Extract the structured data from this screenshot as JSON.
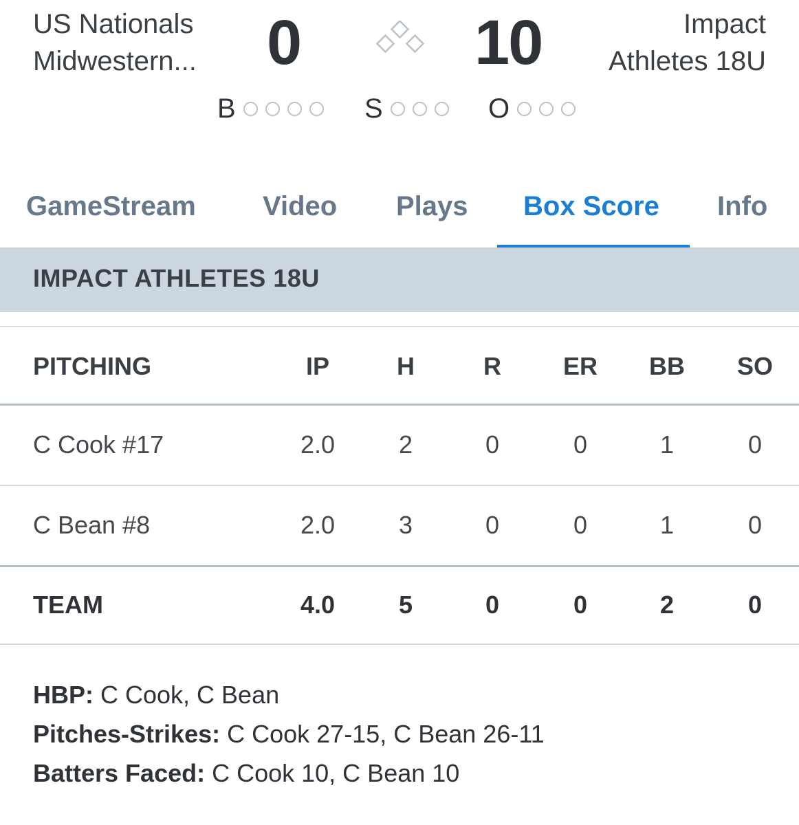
{
  "scoreboard": {
    "away_team_line1": "US Nationals",
    "away_team_line2": "Midwestern...",
    "away_score": "0",
    "home_score": "10",
    "home_team_line1": "Impact",
    "home_team_line2": "Athletes 18U",
    "count": {
      "balls_label": "B",
      "strikes_label": "S",
      "outs_label": "O",
      "balls": 0,
      "strikes": 0,
      "outs": 0
    },
    "base_icon": "bases-diamond-icon"
  },
  "tabs": [
    {
      "label": "GameStream",
      "active": false
    },
    {
      "label": "Video",
      "active": false
    },
    {
      "label": "Plays",
      "active": false
    },
    {
      "label": "Box Score",
      "active": true
    },
    {
      "label": "Info",
      "active": false
    }
  ],
  "section": {
    "team_title": "IMPACT ATHLETES 18U"
  },
  "pitching_table": {
    "headers": [
      "PITCHING",
      "IP",
      "H",
      "R",
      "ER",
      "BB",
      "SO"
    ],
    "rows": [
      {
        "name": "C Cook #17",
        "ip": "2.0",
        "h": "2",
        "r": "0",
        "er": "0",
        "bb": "1",
        "so": "0"
      },
      {
        "name": "C Bean #8",
        "ip": "2.0",
        "h": "3",
        "r": "0",
        "er": "0",
        "bb": "1",
        "so": "0"
      }
    ],
    "team": {
      "name": "TEAM",
      "ip": "4.0",
      "h": "5",
      "r": "0",
      "er": "0",
      "bb": "2",
      "so": "0"
    }
  },
  "notes": [
    {
      "label": "HBP:",
      "value": " C Cook, C Bean"
    },
    {
      "label": "Pitches-Strikes:",
      "value": " C Cook 27-15, C Bean 26-11"
    },
    {
      "label": "Batters Faced:",
      "value": " C Cook 10, C Bean 10"
    }
  ],
  "colors": {
    "accent": "#1a7fd4",
    "tab_inactive": "#66788a",
    "section_bg": "#ccd6de"
  }
}
